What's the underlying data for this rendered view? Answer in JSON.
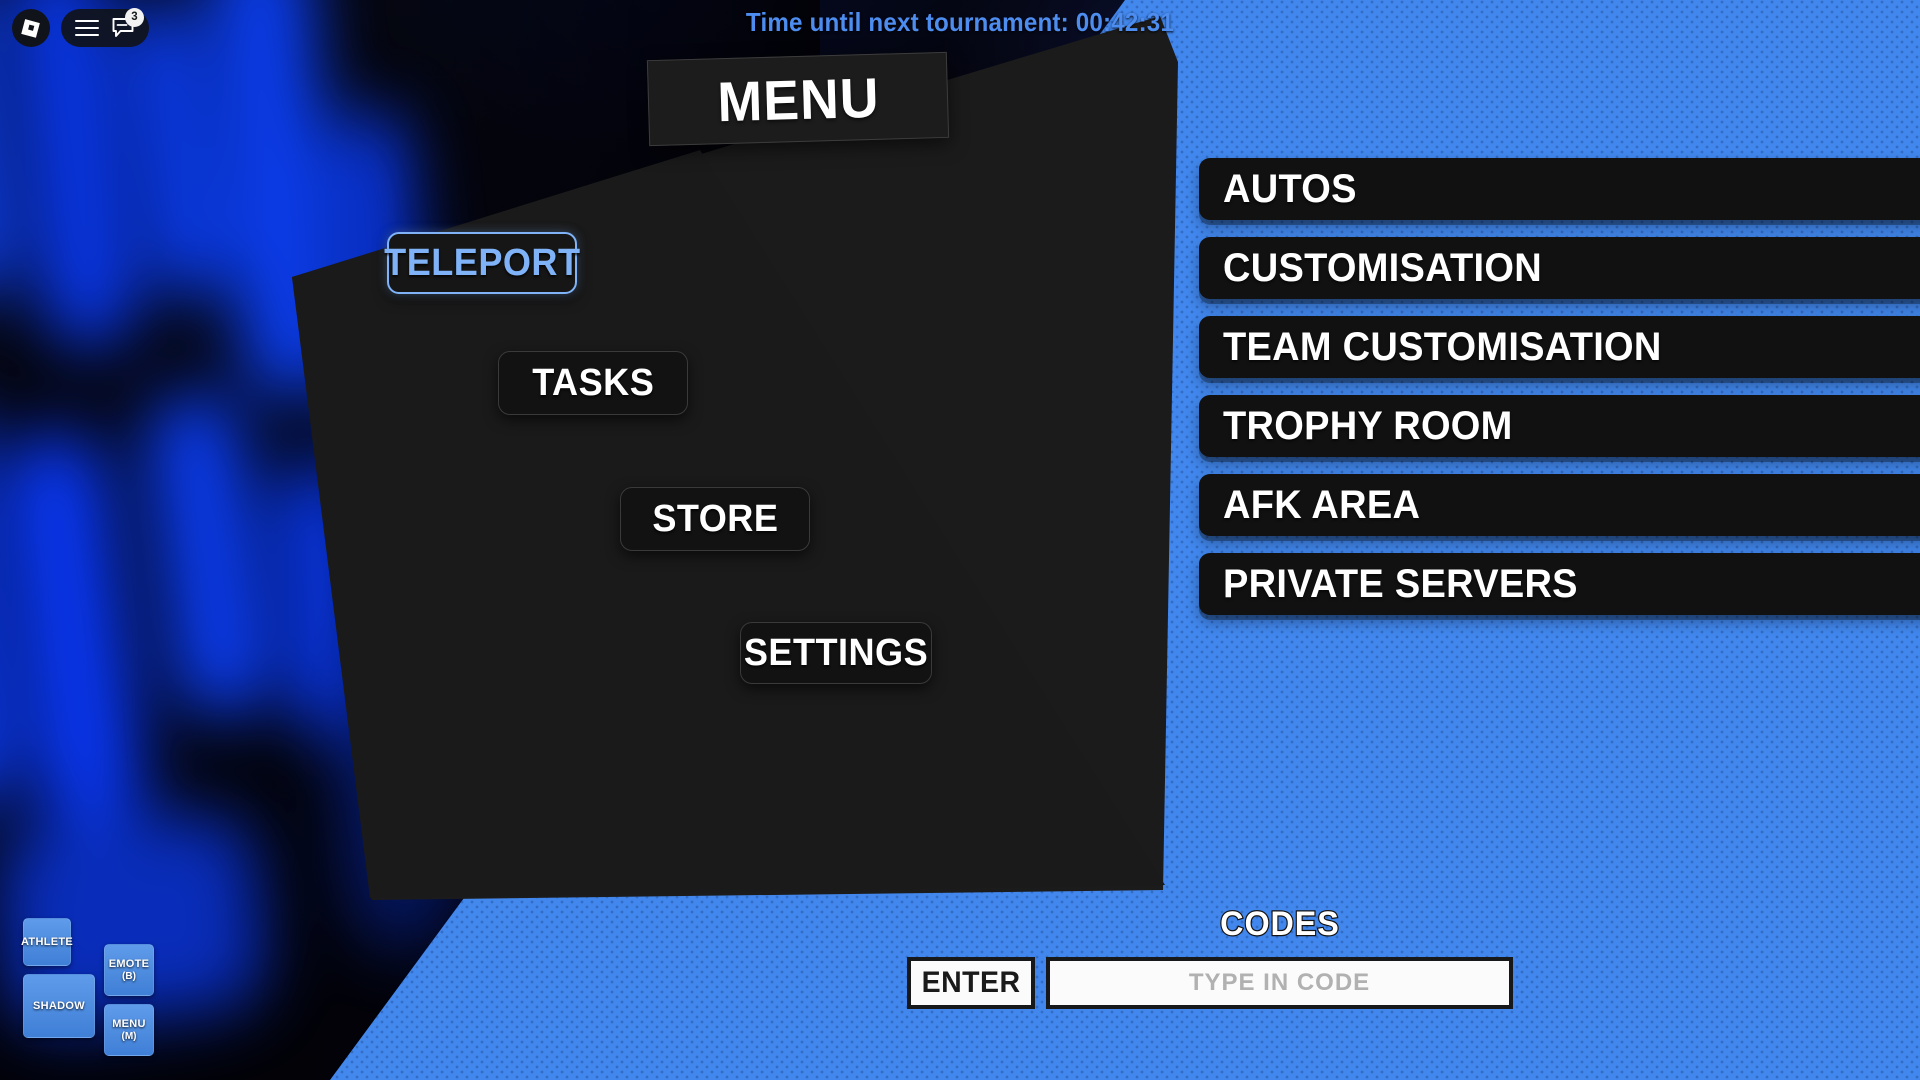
{
  "topbar": {
    "roblox_logo": "roblox-logo",
    "menu_icon": "hamburger-icon",
    "chat_icon": "chat-icon",
    "chat_badge": "3"
  },
  "timer": {
    "text": "Time until next tournament: 00:42:31",
    "color": "#4d8df0"
  },
  "header": {
    "title": "MENU"
  },
  "cascade_buttons": [
    {
      "label": "TELEPORT",
      "selected": true
    },
    {
      "label": "TASKS",
      "selected": false
    },
    {
      "label": "STORE",
      "selected": false
    },
    {
      "label": "SETTINGS",
      "selected": false
    }
  ],
  "nav_list": [
    {
      "label": "AUTOS"
    },
    {
      "label": "CUSTOMISATION"
    },
    {
      "label": "TEAM CUSTOMISATION"
    },
    {
      "label": "TROPHY ROOM"
    },
    {
      "label": "AFK AREA"
    },
    {
      "label": "PRIVATE SERVERS"
    }
  ],
  "codes": {
    "title": "CODES",
    "enter_label": "ENTER",
    "input_value": "",
    "input_placeholder": "TYPE IN CODE"
  },
  "action_buttons": [
    {
      "label": "ATHLETE",
      "key": ""
    },
    {
      "label": "SHADOW",
      "key": ""
    },
    {
      "label": "EMOTE",
      "key": "(B)"
    },
    {
      "label": "MENU",
      "key": "(M)"
    }
  ],
  "colors": {
    "accent_blue": "#4187ed",
    "panel_dark": "#111111",
    "selected_blue": "#7fb2f7",
    "neon_blue": "#0b3bff"
  }
}
